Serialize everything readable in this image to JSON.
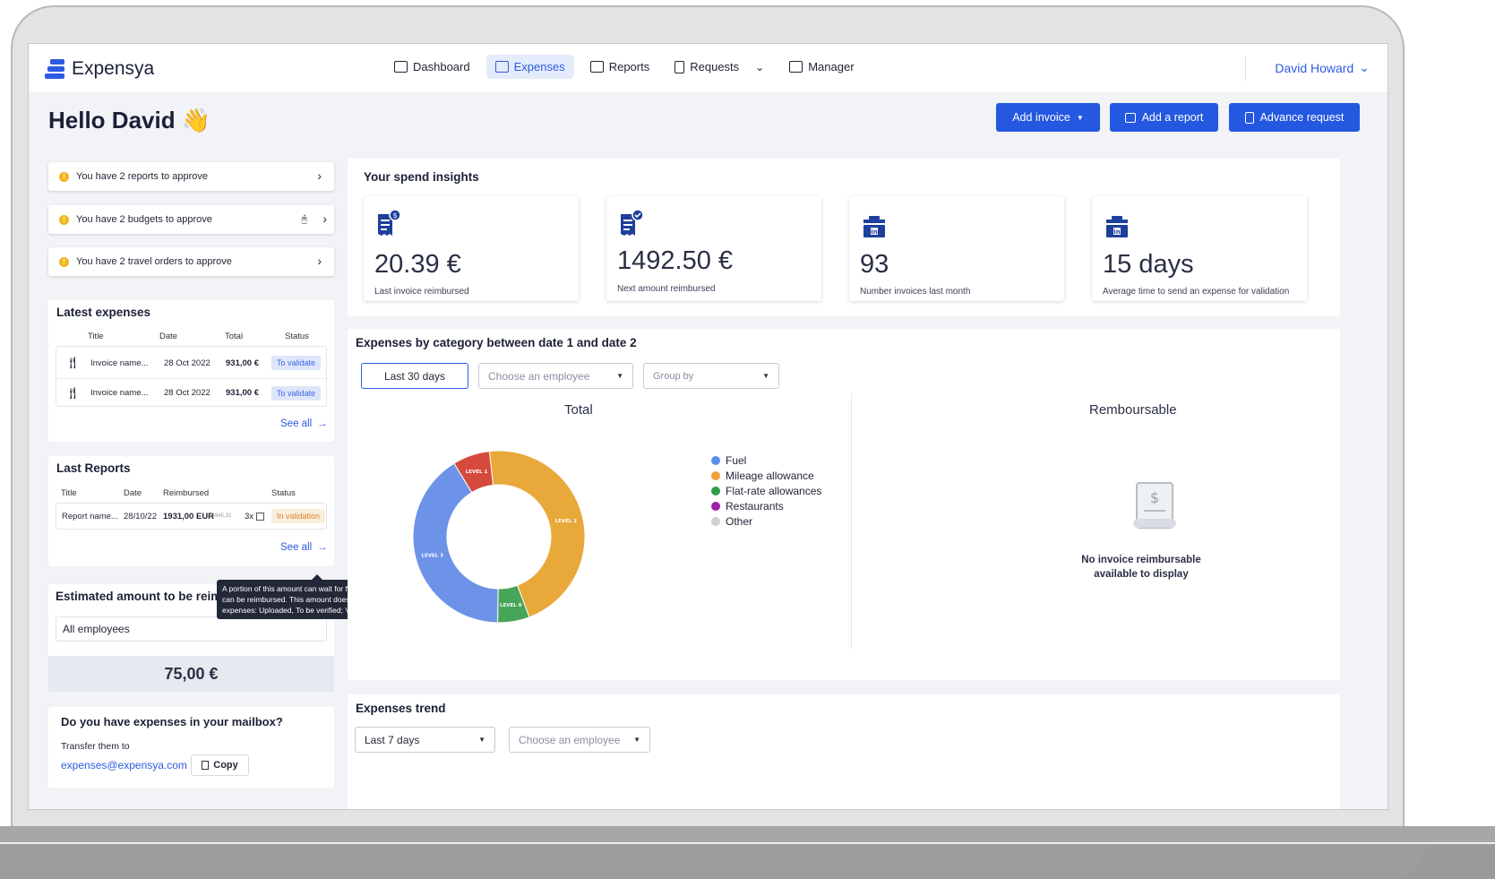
{
  "app": {
    "name": "Expensya"
  },
  "nav": {
    "items": [
      {
        "label": "Dashboard",
        "icon": "dashboard-icon",
        "active": false
      },
      {
        "label": "Expenses",
        "icon": "expenses-icon",
        "active": true
      },
      {
        "label": "Reports",
        "icon": "reports-icon",
        "active": false
      },
      {
        "label": "Requests",
        "icon": "requests-icon",
        "active": false
      },
      {
        "label": "Manager",
        "icon": "manager-icon",
        "active": false
      }
    ],
    "user": "David Howard"
  },
  "greeting": {
    "text": "Hello David",
    "emoji": "👋"
  },
  "actions": {
    "add_invoice": "Add invoice",
    "add_report": "Add a report",
    "advance_request": "Advance request"
  },
  "alerts": [
    "You have 2 reports to approve",
    "You have 2 budgets to approve",
    "You have 2 travel orders to approve"
  ],
  "latest_expenses": {
    "title": "Latest expenses",
    "columns": [
      "Title",
      "Date",
      "Total",
      "Status"
    ],
    "rows": [
      {
        "title": "Invoice name...",
        "date": "28 Oct 2022",
        "total": "931,00 €",
        "status": "To validate"
      },
      {
        "title": "Invoice name...",
        "date": "28 Oct 2022",
        "total": "931,00 €",
        "status": "To validate"
      }
    ],
    "see_all": "See all"
  },
  "last_reports": {
    "title": "Last Reports",
    "columns": [
      "Title",
      "Date",
      "Reimbursed",
      "Status"
    ],
    "rows": [
      {
        "title": "Report name...",
        "date": "28/10/22",
        "reimbursed": "1931,00 EUR",
        "reimbursed_sub": "/1945,32",
        "count": "3x",
        "status": "In validation"
      }
    ],
    "see_all": "See all"
  },
  "estimated": {
    "title": "Estimated amount to be reimbursed",
    "select": "All employees",
    "amount": "75,00 €",
    "tooltip": "A portion of this amount can wait for final reporting so it can be reimbursed. This amount does not include expenses: Uploaded, To be verified; Verified; Archived."
  },
  "mailbox": {
    "title": "Do you have expenses in your mailbox?",
    "subtitle": "Transfer them to",
    "email": "expenses@expensya.com",
    "copy": "Copy"
  },
  "insights": {
    "title": "Your spend insights",
    "cards": [
      {
        "value": "20.39 €",
        "label": "Last invoice reimbursed",
        "icon": "receipt-icon"
      },
      {
        "value": "1492.50 €",
        "label": "Next amount reimbursed",
        "icon": "receipt-check-icon"
      },
      {
        "value": "93",
        "label": "Number invoices last month",
        "icon": "briefcase-icon"
      },
      {
        "value": "15 days",
        "label": "Average time to send an expense for validation",
        "icon": "briefcase-icon"
      }
    ]
  },
  "category": {
    "title": "Expenses by category between date 1 and date 2",
    "period": "Last 30 days",
    "employee_placeholder": "Choose an employee",
    "group_placeholder": "Group by",
    "total_title": "Total",
    "remb_title": "Remboursable",
    "empty_line1": "No invoice reimbursable",
    "empty_line2": "available to display"
  },
  "legend": [
    {
      "name": "Fuel",
      "color": "#5b8def"
    },
    {
      "name": "Mileage allowance",
      "color": "#f0a13a"
    },
    {
      "name": "Flat-rate allowances",
      "color": "#2f9e4a"
    },
    {
      "name": "Restaurants",
      "color": "#a020a8"
    },
    {
      "name": "Other",
      "color": "#cfcfcf"
    }
  ],
  "chart_data": {
    "type": "pie",
    "labels": [
      "LEVEL 1",
      "LEVEL 2",
      "LEVEL 0",
      "LEVEL 3"
    ],
    "values": [
      7,
      46,
      6,
      41
    ],
    "colors": [
      "#d64a3e",
      "#e8a83a",
      "#47a557",
      "#6d93e8"
    ]
  },
  "trend": {
    "title": "Expenses trend",
    "period": "Last 7 days",
    "employee_placeholder": "Choose an employee"
  }
}
